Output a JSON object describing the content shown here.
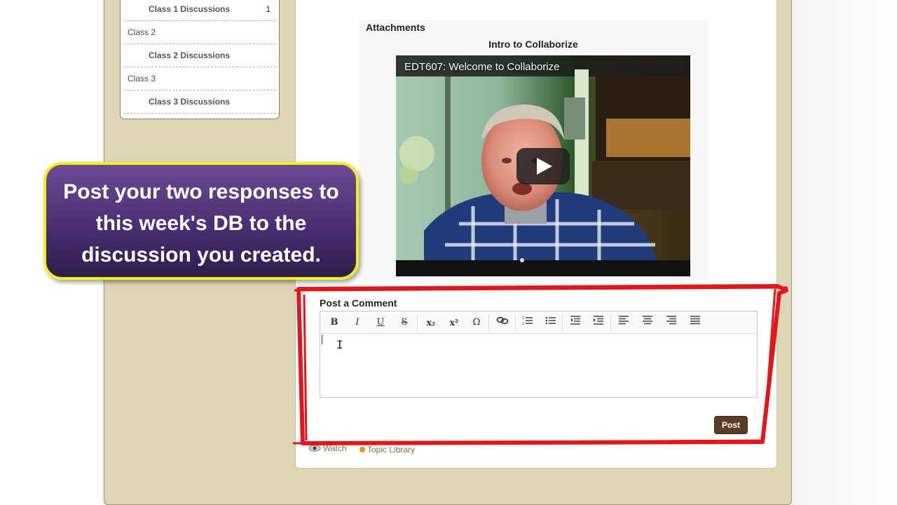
{
  "sidebar": {
    "items": [
      {
        "label": "Class 1 Discussions",
        "count": "1"
      },
      {
        "label": "Class 2"
      },
      {
        "label": "Class 2 Discussions"
      },
      {
        "label": "Class 3"
      },
      {
        "label": "Class 3 Discussions"
      }
    ]
  },
  "attachments": {
    "heading": "Attachments",
    "video_title": "Intro to Collaborize",
    "video_caption": "EDT607: Welcome to Collaborize"
  },
  "callout": {
    "lines": [
      "Post your two responses to",
      "this week's DB to the",
      "discussion you created."
    ]
  },
  "comment": {
    "label": "Post a Comment",
    "toolbar": [
      "B",
      "I",
      "U",
      "S",
      "x₂",
      "x²",
      "Ω",
      "link",
      "numbered-list",
      "bullet-list",
      "outdent",
      "indent",
      "align-left",
      "align-center",
      "align-right",
      "justify"
    ],
    "post_label": "Post"
  },
  "footer": {
    "watch": "Watch",
    "topic_library": "Topic Library"
  },
  "colors": {
    "frame": "#dcd5b6",
    "callout_border": "#f1ee1c",
    "callout_fill": "#4a2f73",
    "annotation_red": "#e0171b",
    "post_button": "#5a3d24"
  }
}
